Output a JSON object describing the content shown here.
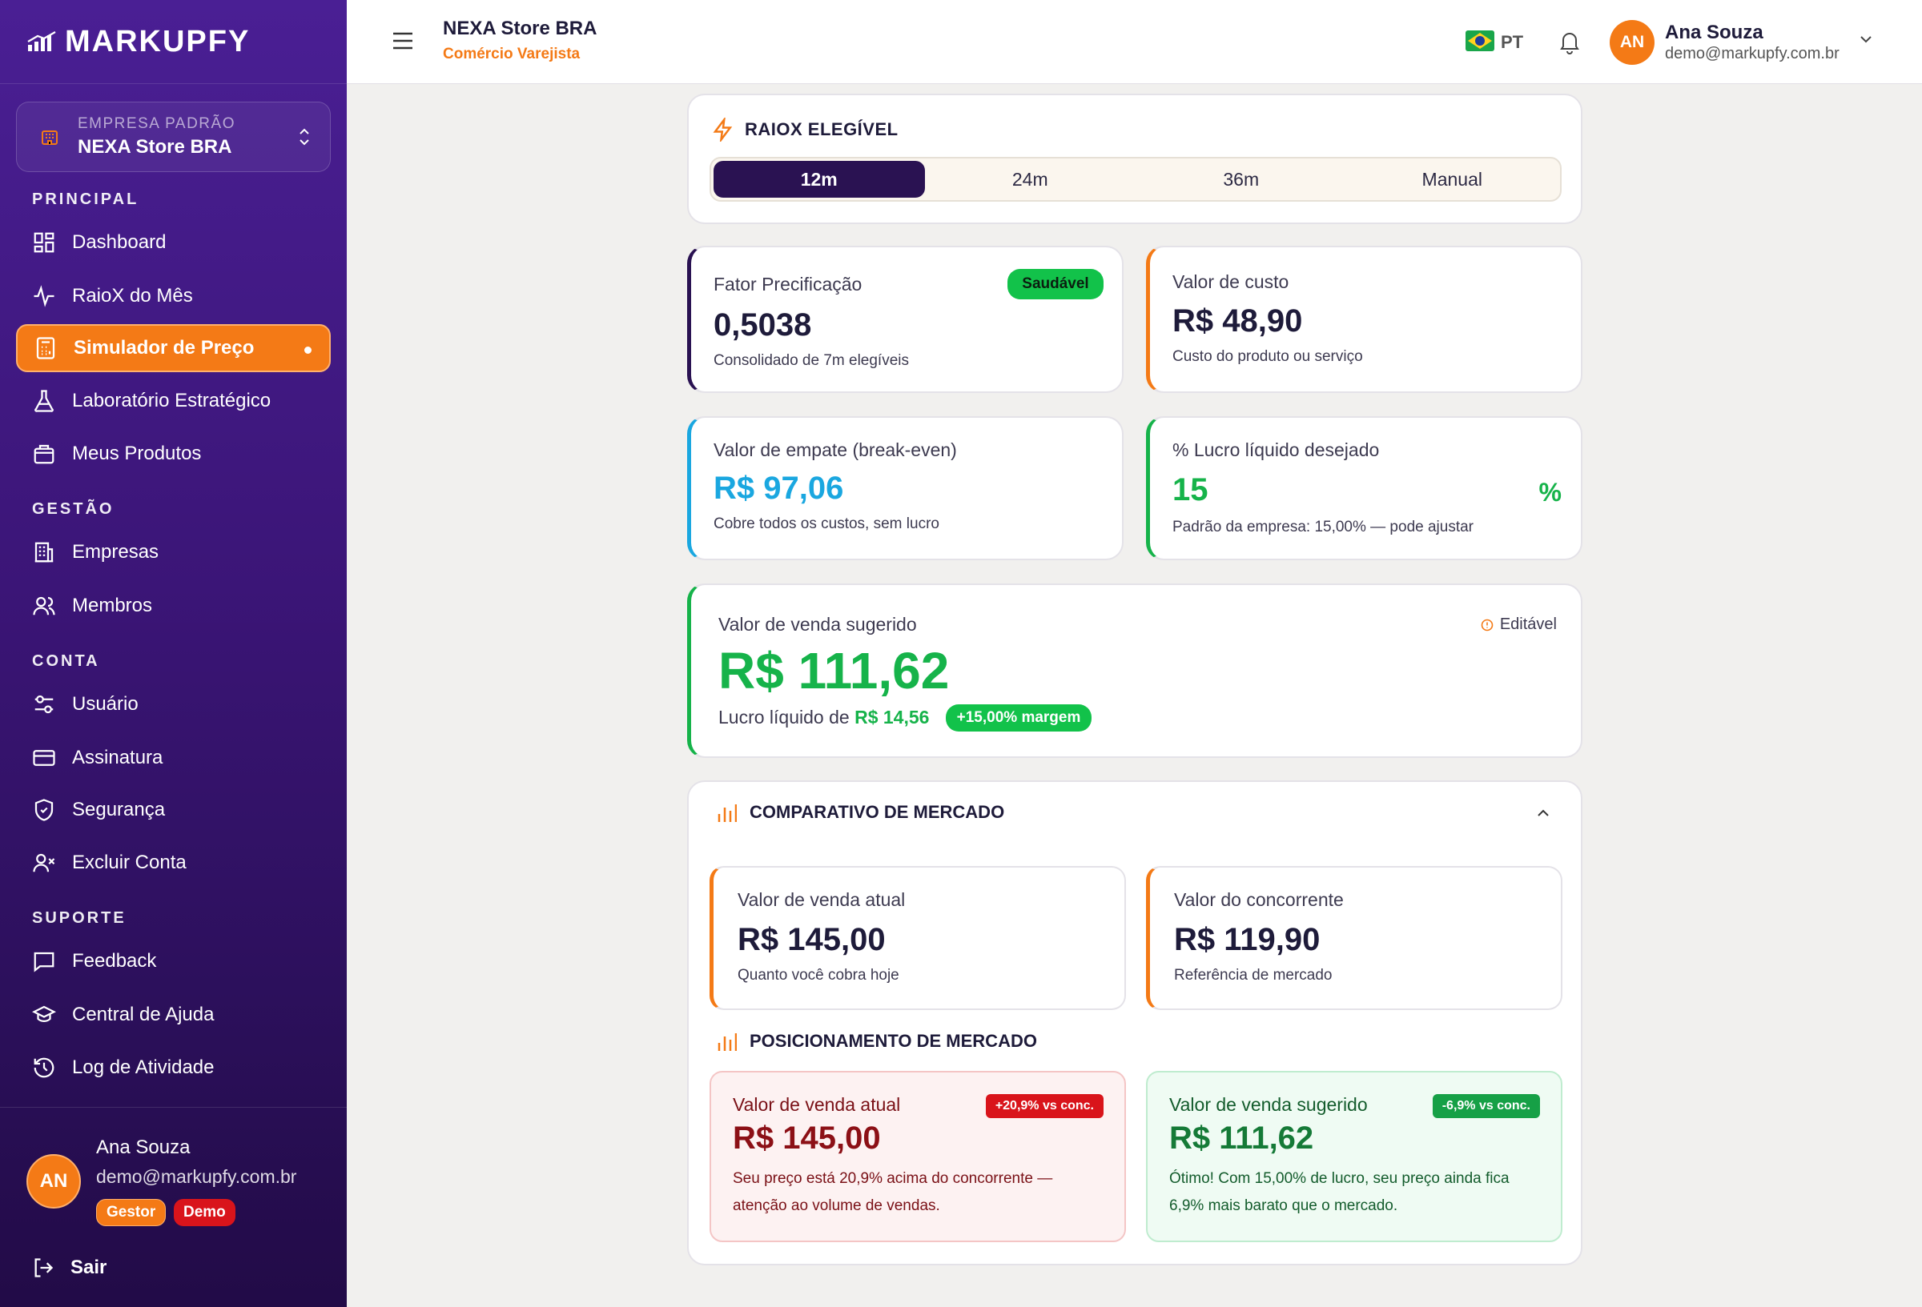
{
  "brand": {
    "name": "MARKUPFY"
  },
  "company_selector": {
    "label": "EMPRESA PADRÃO",
    "value": "NEXA Store BRA"
  },
  "sidebar": {
    "sections": [
      {
        "title": "PRINCIPAL"
      },
      {
        "title": "GESTÃO"
      },
      {
        "title": "CONTA"
      },
      {
        "title": "SUPORTE"
      }
    ],
    "items": [
      {
        "label": "Dashboard",
        "icon": "grid-icon"
      },
      {
        "label": "RaioX do Mês",
        "icon": "activity-icon"
      },
      {
        "label": "Simulador de Preço",
        "icon": "calculator-icon",
        "active": true
      },
      {
        "label": "Laboratório Estratégico",
        "icon": "flask-icon"
      },
      {
        "label": "Meus Produtos",
        "icon": "box-icon"
      },
      {
        "label": "Empresas",
        "icon": "building-icon"
      },
      {
        "label": "Membros",
        "icon": "users-icon"
      },
      {
        "label": "Usuário",
        "icon": "sliders-icon"
      },
      {
        "label": "Assinatura",
        "icon": "credit-card-icon"
      },
      {
        "label": "Segurança",
        "icon": "shield-icon"
      },
      {
        "label": "Excluir Conta",
        "icon": "user-x-icon"
      },
      {
        "label": "Feedback",
        "icon": "message-icon"
      },
      {
        "label": "Central de Ajuda",
        "icon": "graduation-icon"
      },
      {
        "label": "Log de Atividade",
        "icon": "history-icon"
      }
    ],
    "user": {
      "initials": "AN",
      "name": "Ana Souza",
      "email": "demo@markupfy.com.br",
      "badges": [
        "Gestor",
        "Demo"
      ]
    },
    "logout": "Sair"
  },
  "header": {
    "store_name": "NEXA Store BRA",
    "store_type": "Comércio Varejista",
    "lang": "PT",
    "user": {
      "initials": "AN",
      "name": "Ana Souza",
      "email": "demo@markupfy.com.br"
    }
  },
  "raiox": {
    "title": "RAIOX ELEGÍVEL",
    "options": [
      "12m",
      "24m",
      "36m",
      "Manual"
    ],
    "selected": "12m"
  },
  "metrics": {
    "fator": {
      "label": "Fator Precificação",
      "badge": "Saudável",
      "value": "0,5038",
      "sub": "Consolidado de 7m elegíveis"
    },
    "custo": {
      "label": "Valor de custo",
      "value": "R$ 48,90",
      "sub": "Custo do produto ou serviço"
    },
    "empate": {
      "label": "Valor de empate (break-even)",
      "value": "R$ 97,06",
      "sub": "Cobre todos os custos, sem lucro"
    },
    "lucro": {
      "label": "% Lucro líquido desejado",
      "value": "15",
      "unit": "%",
      "sub": "Padrão da empresa: 15,00% — pode ajustar"
    }
  },
  "sale": {
    "label": "Valor de venda sugerido",
    "editable": "Editável",
    "value": "R$ 111,62",
    "profit_prefix": "Lucro líquido de",
    "profit_value": "R$ 14,56",
    "margin_badge": "+15,00% margem"
  },
  "market": {
    "title": "COMPARATIVO DE MERCADO",
    "current": {
      "label": "Valor de venda atual",
      "value": "R$ 145,00",
      "sub": "Quanto você cobra hoje"
    },
    "competitor": {
      "label": "Valor do concorrente",
      "value": "R$ 119,90",
      "sub": "Referência de mercado"
    },
    "positioning_title": "POSICIONAMENTO DE MERCADO",
    "pos_current": {
      "label": "Valor de venda atual",
      "tag": "+20,9% vs conc.",
      "value": "R$ 145,00",
      "text1": "Seu preço está 20,9% acima do concorrente —",
      "text2": "atenção ao volume de vendas."
    },
    "pos_suggested": {
      "label": "Valor de venda sugerido",
      "tag": "-6,9% vs conc.",
      "value": "R$ 111,62",
      "text1": "Ótimo! Com 15,00% de lucro, seu preço ainda fica",
      "text2": "6,9% mais barato que o mercado."
    }
  },
  "colors": {
    "accent": "#f47a16",
    "sidebar": "#3b1577",
    "positive": "#16b34a",
    "negative": "#b3141b",
    "info": "#1aa7e0"
  }
}
